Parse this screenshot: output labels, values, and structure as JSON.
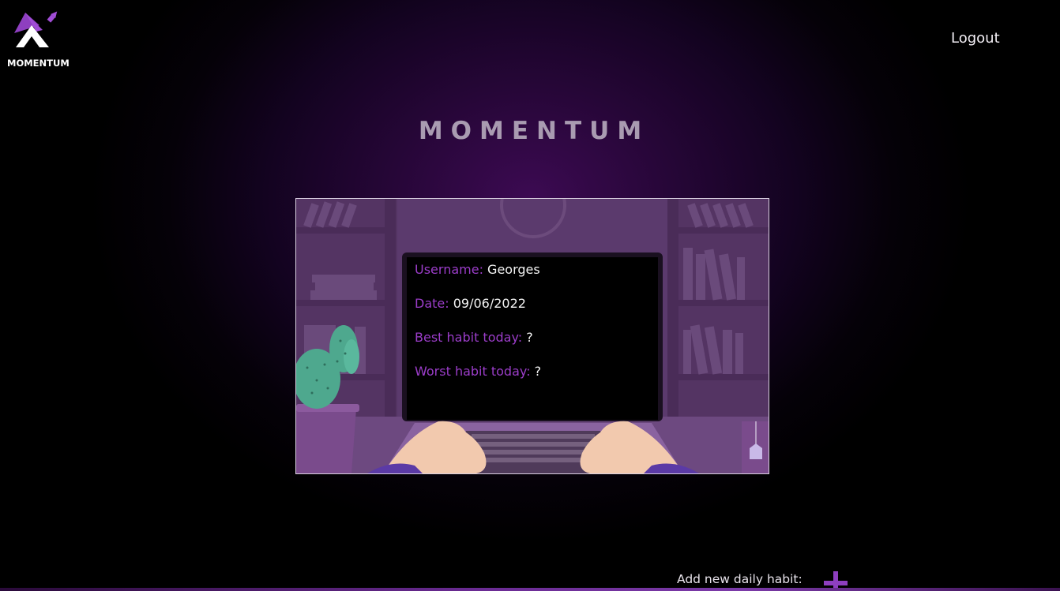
{
  "brand": {
    "logo_text": "MOMENTUM",
    "accent_color": "#9b3dc9"
  },
  "header": {
    "logout_label": "Logout"
  },
  "main": {
    "title": "MOMENTUM"
  },
  "profile": {
    "username_label": "Username:",
    "username_value": "Georges",
    "date_label": "Date:",
    "date_value": "09/06/2022",
    "best_label": "Best habit today:",
    "best_value": "?",
    "worst_label": "Worst habit today:",
    "worst_value": "?"
  },
  "footer": {
    "add_label": "Add new daily habit:",
    "add_icon": "plus-icon"
  }
}
